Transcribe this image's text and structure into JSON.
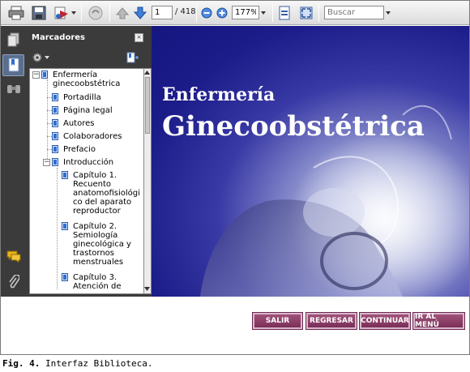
{
  "toolbar": {
    "page_current": "1",
    "page_total": "/ 418",
    "zoom": "177%",
    "search_placeholder": "Buscar",
    "icons": [
      "print-icon",
      "save-icon",
      "pdf-share-icon",
      "hand-icon",
      "page-up-icon",
      "page-down-icon",
      "zoom-out-icon",
      "zoom-in-icon",
      "fit-page-icon",
      "fullscreen-icon"
    ]
  },
  "bookmarks": {
    "title": "Marcadores",
    "close": "×",
    "items": {
      "root": [
        "Enfermería",
        "ginecoobstétrica"
      ],
      "portadilla": "Portadilla",
      "pagina_legal": "Página legal",
      "autores": "Autores",
      "colaboradores": "Colaboradores",
      "prefacio": "Prefacio",
      "introduccion": "Introducción",
      "cap1": [
        "Capítulo 1.",
        "Recuento",
        "anatomofisiológi",
        "co del aparato",
        "reproductor"
      ],
      "cap2": [
        "Capítulo 2.",
        "Semiología",
        "ginecológica y",
        "trastornos",
        "menstruales"
      ],
      "cap3": [
        "Capítulo 3.",
        "Atención de"
      ]
    }
  },
  "document": {
    "subtitle": "Enfermería",
    "title": "Ginecoobstétrica"
  },
  "menu": {
    "salir": "SALIR",
    "regresar": "REGRESAR",
    "continuar": "CONTINUAR",
    "ir_al_menu": "IR AL MENÚ"
  },
  "caption": {
    "label": "Fig. 4.",
    "text": "Interfaz Biblioteca."
  },
  "colors": {
    "panel": "#3b3b3b",
    "doc_bg": "#1c1c8a",
    "button": "#8a3a66"
  }
}
